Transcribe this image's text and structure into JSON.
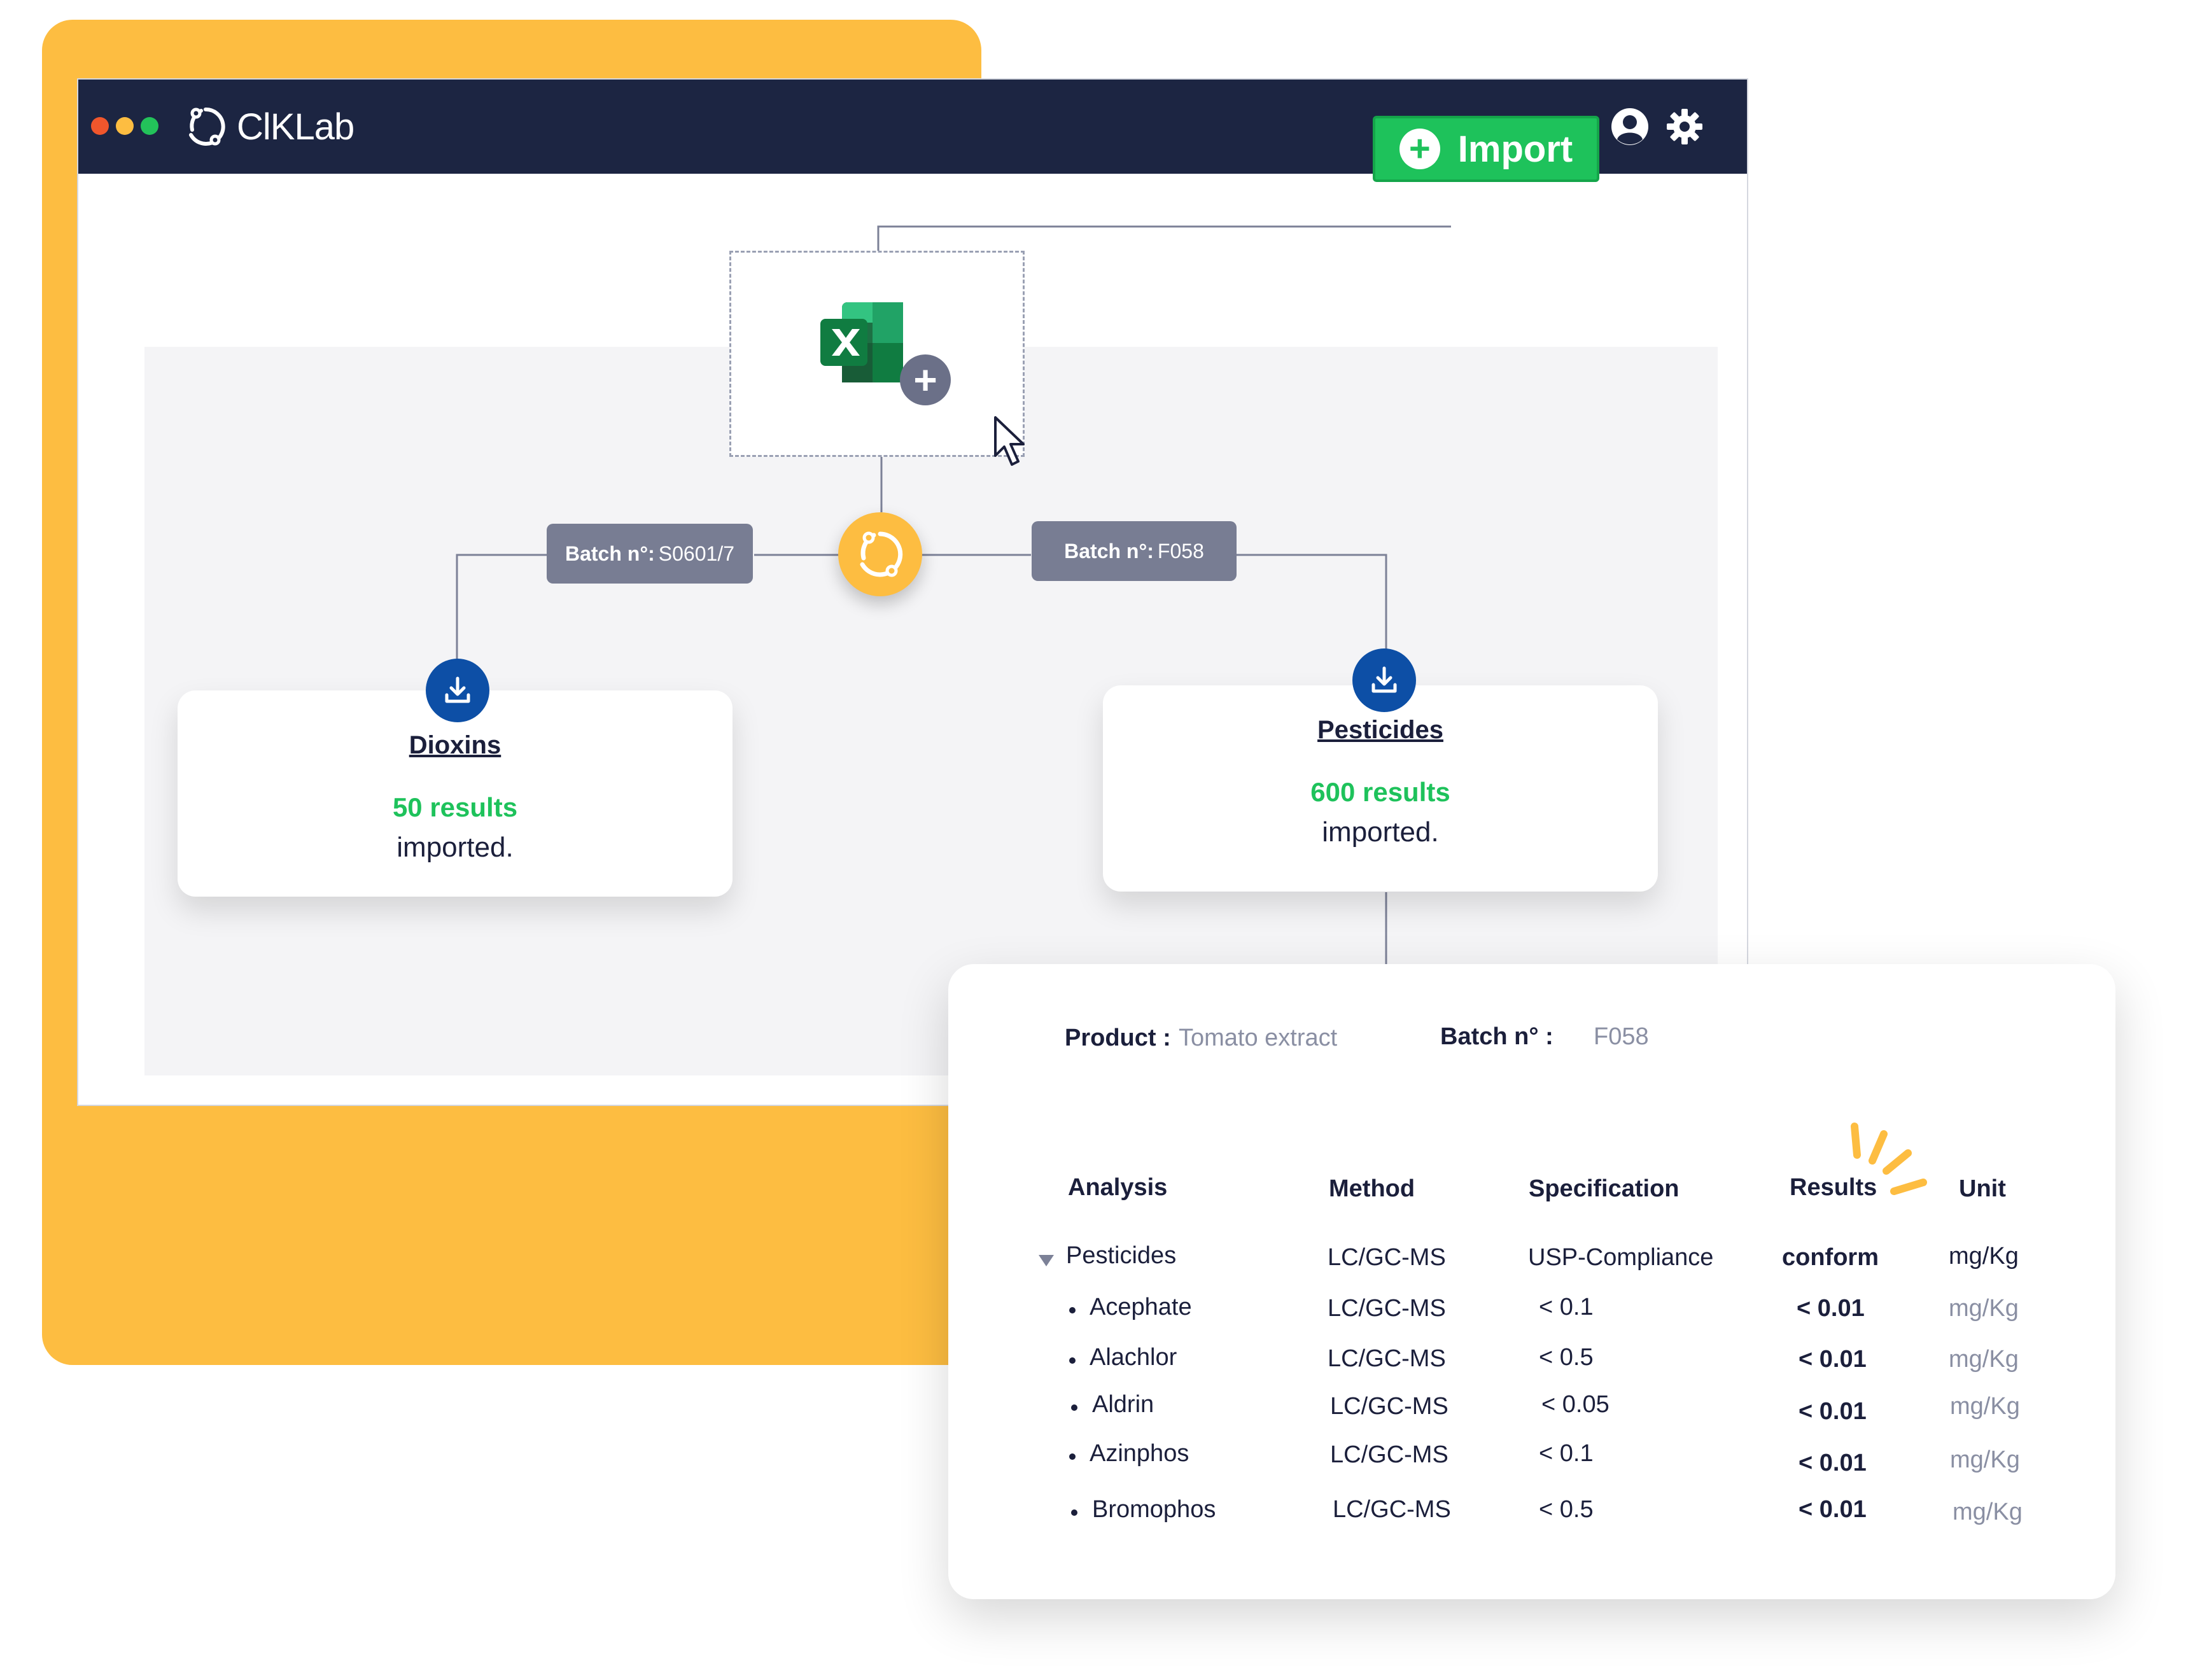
{
  "app": {
    "brand": "ClKLab"
  },
  "toolbar": {
    "import_label": "Import"
  },
  "batches": {
    "left": {
      "label": "Batch n°:",
      "value": "S0601/7"
    },
    "right": {
      "label": "Batch n°:",
      "value": "F058"
    }
  },
  "cards": {
    "dioxins": {
      "title": "Dioxins",
      "count": "50 results",
      "note": "imported."
    },
    "pesticides": {
      "title": "Pesticides",
      "count": "600 results",
      "note": "imported."
    }
  },
  "detail": {
    "product_label": "Product :",
    "product_value": "Tomato extract",
    "batch_label": "Batch n° :",
    "batch_value": "F058",
    "columns": [
      "Analysis",
      "Method",
      "Specification",
      "Results",
      "Unit"
    ],
    "rows": [
      {
        "analysis": "Pesticides",
        "method": "LC/GC-MS",
        "spec": "USP-Compliance",
        "result": "conform",
        "unit": "mg/Kg"
      },
      {
        "analysis": "Acephate",
        "method": "LC/GC-MS",
        "spec": "< 0.1",
        "result": "< 0.01",
        "unit": "mg/Kg"
      },
      {
        "analysis": "Alachlor",
        "method": "LC/GC-MS",
        "spec": "< 0.5",
        "result": "< 0.01",
        "unit": "mg/Kg"
      },
      {
        "analysis": "Aldrin",
        "method": "LC/GC-MS",
        "spec": "< 0.05",
        "result": "< 0.01",
        "unit": "mg/Kg"
      },
      {
        "analysis": "Azinphos",
        "method": "LC/GC-MS",
        "spec": "< 0.1",
        "result": "< 0.01",
        "unit": "mg/Kg"
      },
      {
        "analysis": "Bromophos",
        "method": "LC/GC-MS",
        "spec": "< 0.5",
        "result": "< 0.01",
        "unit": "mg/Kg"
      }
    ]
  },
  "colors": {
    "accent_orange": "#fdbd41",
    "titlebar_navy": "#1c2542",
    "import_green": "#1ec25b",
    "download_blue": "#0d4fa6",
    "tag_gray": "#787d93",
    "excel_green": "#1d7044"
  },
  "icons": {
    "window_controls": [
      "red-dot",
      "yellow-dot",
      "green-dot"
    ],
    "logo": "ring-logo-icon",
    "user": "user-icon",
    "settings": "gear-icon",
    "import": "plus-icon",
    "file": "excel-icon",
    "add_file": "plus-circle-icon",
    "cursor": "pointer-cursor-icon",
    "hub": "sync-icon",
    "download": "download-icon",
    "expand": "triangle-down-icon",
    "highlight": "sparkle-icon"
  }
}
